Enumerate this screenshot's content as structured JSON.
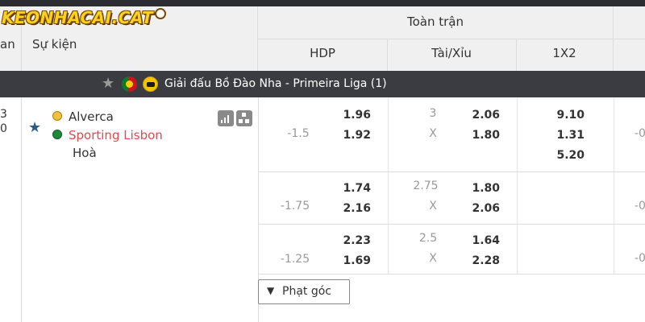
{
  "brand": {
    "logo_text": "KEONHACAI.CAT"
  },
  "header": {
    "time_col_label": "an",
    "event_col_label": "Sự kiện",
    "fulltime_label": "Toàn trận",
    "markets": {
      "hdp": "HDP",
      "ou": "Tài/Xỉu",
      "x12": "1X2"
    }
  },
  "league": {
    "name": "Giải đấu Bồ Đào Nha - Primeira Liga (1)"
  },
  "match": {
    "time_top": "3",
    "time_bottom": "0",
    "home_team": "Alverca",
    "away_team": "Sporting Lisbon",
    "draw_label": "Hoà"
  },
  "odds_rows": [
    {
      "handicap": "-1.5",
      "hdp_home": "1.96",
      "hdp_away": "1.92",
      "ou_line": "3",
      "ou_x": "X",
      "ou_over": "2.06",
      "ou_under": "1.80",
      "x12_home": "9.10",
      "x12_away": "1.31",
      "x12_draw": "5.20",
      "cut_value": "-0"
    },
    {
      "handicap": "-1.75",
      "hdp_home": "1.74",
      "hdp_away": "2.16",
      "ou_line": "2.75",
      "ou_x": "X",
      "ou_over": "1.80",
      "ou_under": "2.06",
      "cut_value": "-0"
    },
    {
      "handicap": "-1.25",
      "hdp_home": "2.23",
      "hdp_away": "1.69",
      "ou_line": "2.5",
      "ou_x": "X",
      "ou_over": "1.64",
      "ou_under": "2.28",
      "cut_value": "-0"
    }
  ],
  "corner_button": {
    "label": "Phạt góc",
    "icon": "chevron-down-icon"
  }
}
